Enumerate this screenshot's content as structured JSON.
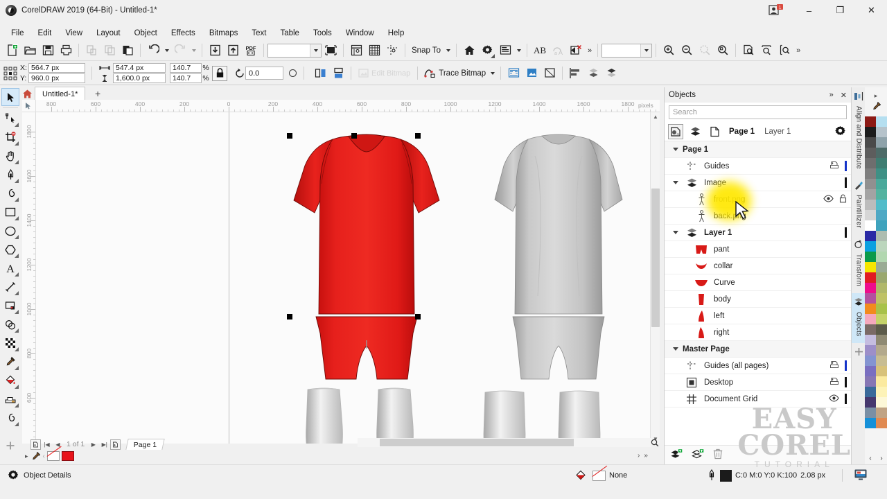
{
  "window": {
    "title": "CorelDRAW 2019 (64-Bit) - Untitled-1*",
    "minimize": "–",
    "maximize": "❐",
    "close": "✕"
  },
  "menubar": {
    "items": [
      {
        "label": "File",
        "accel": "F"
      },
      {
        "label": "Edit",
        "accel": "E"
      },
      {
        "label": "View",
        "accel": "V"
      },
      {
        "label": "Layout",
        "accel": "L"
      },
      {
        "label": "Object",
        "accel": "b"
      },
      {
        "label": "Effects",
        "accel": "c"
      },
      {
        "label": "Bitmaps",
        "accel": "B"
      },
      {
        "label": "Text",
        "accel": "x"
      },
      {
        "label": "Table",
        "accel": "T"
      },
      {
        "label": "Tools",
        "accel": "o"
      },
      {
        "label": "Window",
        "accel": "W"
      },
      {
        "label": "Help",
        "accel": "H"
      }
    ]
  },
  "standard_toolbar": {
    "snap_to_label": "Snap To",
    "pdf_label": "PDF",
    "text_label": "AB",
    "zoom_level_value": "",
    "zoom_level_placeholder": "",
    "overflow_label": "»",
    "icons": [
      "new-document-icon",
      "open-document-icon",
      "save-document-icon",
      "print-icon",
      "cut-icon",
      "copy-icon",
      "paste-icon",
      "undo-icon",
      "redo-icon",
      "import-icon",
      "export-icon",
      "publish-pdf-icon",
      "zoom-levels-combo",
      "full-screen-preview-icon",
      "show-rulers-icon",
      "show-grid-icon",
      "show-guides-icon",
      "snap-to-icon",
      "welcome-screen-icon",
      "options-icon",
      "application-launcher-icon",
      "text-properties-icon",
      "alignment-guides-icon",
      "clear-transform-icon",
      "zoom-in-icon",
      "zoom-out-icon",
      "zoom-selected-icon",
      "zoom-all-objects-icon",
      "zoom-page-icon",
      "zoom-page-width-icon",
      "zoom-page-height-icon"
    ]
  },
  "property_bar": {
    "x_label": "X:",
    "y_label": "Y:",
    "x_value": "564.7 px",
    "y_value": "960.0 px",
    "width_value": "547.4 px",
    "height_value": "1,600.0 px",
    "scale_w_value": "140.7",
    "scale_h_value": "140.7",
    "percent_symbol": "%",
    "rotation_value": "0.0",
    "trace_bitmap_label": "Trace Bitmap",
    "edit_bitmap_label": "Edit Bitmap"
  },
  "document_tabs": {
    "home_icon": "home-icon",
    "active_tab": "Untitled-1*",
    "new_tab_label": "+"
  },
  "toolbox": {
    "tools": [
      {
        "name": "pick-tool",
        "active": true
      },
      {
        "name": "shape-tool",
        "active": false
      },
      {
        "name": "crop-tool",
        "active": false
      },
      {
        "name": "pan-tool",
        "active": false
      },
      {
        "name": "pen-tool",
        "active": false
      },
      {
        "name": "freehand-tool",
        "active": false
      },
      {
        "name": "rectangle-tool",
        "active": false
      },
      {
        "name": "ellipse-tool",
        "active": false
      },
      {
        "name": "polygon-tool",
        "active": false
      },
      {
        "name": "text-tool",
        "active": false
      },
      {
        "name": "dimension-tool",
        "active": false
      },
      {
        "name": "drop-shadow-tool",
        "active": false
      },
      {
        "name": "transparency-tool",
        "active": false
      },
      {
        "name": "pattern-fill-tool",
        "active": false
      },
      {
        "name": "color-eyedropper-tool",
        "active": false
      },
      {
        "name": "interactive-fill-tool",
        "active": false
      },
      {
        "name": "smart-fill-tool",
        "active": false
      },
      {
        "name": "connector-tool",
        "active": false
      },
      {
        "name": "add-tool-button",
        "active": false
      }
    ]
  },
  "rulers": {
    "unit": "pixels",
    "h_labels": [
      "800",
      "600",
      "400",
      "200",
      "0",
      "200",
      "400",
      "600",
      "800",
      "1000",
      "1200",
      "1400",
      "1600",
      "1800"
    ],
    "v_labels": [
      "1800",
      "1600",
      "1400",
      "1200",
      "1000",
      "800",
      "600"
    ]
  },
  "page_navigator": {
    "page_indicator": "1 of 1",
    "page_tab": "Page 1"
  },
  "status_bar": {
    "object_details_label": "Object Details",
    "fill_label": "None",
    "outline_color": "C:0 M:0 Y:0 K:100",
    "outline_width": "2.08 px"
  },
  "docker": {
    "title": "Objects",
    "collapse_icon": "»",
    "close_icon": "✕",
    "search_placeholder": "Search",
    "page_label": "Page 1",
    "layer_label": "Layer 1",
    "tree": [
      {
        "id": "page-1",
        "label": "Page 1",
        "icon": "page-icon",
        "indent": 0,
        "bold": true,
        "expander": true,
        "type": "group"
      },
      {
        "id": "guides",
        "label": "Guides",
        "icon": "guides-icon",
        "indent": 1,
        "bold": false,
        "expander": false,
        "type": "layer",
        "print_icon": true,
        "color": "#1433c8"
      },
      {
        "id": "image",
        "label": "Image",
        "icon": "layer-icon",
        "indent": 1,
        "bold": false,
        "expander": true,
        "type": "layer",
        "color": "#111111"
      },
      {
        "id": "front-png",
        "label": "front.png",
        "icon": "bitmap-icon",
        "indent": 2,
        "bold": false,
        "type": "object",
        "eye_icon": true,
        "lock_icon": true,
        "highlighted": true
      },
      {
        "id": "back-png",
        "label": "back.png",
        "icon": "bitmap-icon",
        "indent": 2,
        "bold": false,
        "type": "object"
      },
      {
        "id": "layer-1",
        "label": "Layer 1",
        "icon": "layer-icon",
        "indent": 1,
        "bold": true,
        "expander": true,
        "type": "layer",
        "color": "#111111"
      },
      {
        "id": "pant",
        "label": "pant",
        "icon": "shape-pant-icon",
        "indent": 2,
        "bold": false,
        "type": "object"
      },
      {
        "id": "collar",
        "label": "collar",
        "icon": "shape-collar-icon",
        "indent": 2,
        "bold": false,
        "type": "object"
      },
      {
        "id": "curve",
        "label": "Curve",
        "icon": "shape-curve-icon",
        "indent": 2,
        "bold": false,
        "type": "object"
      },
      {
        "id": "body",
        "label": "body",
        "icon": "shape-body-icon",
        "indent": 2,
        "bold": false,
        "type": "object"
      },
      {
        "id": "left",
        "label": "left",
        "icon": "shape-left-icon",
        "indent": 2,
        "bold": false,
        "type": "object"
      },
      {
        "id": "right",
        "label": "right",
        "icon": "shape-right-icon",
        "indent": 2,
        "bold": false,
        "type": "object"
      },
      {
        "id": "master-page",
        "label": "Master Page",
        "icon": "page-icon",
        "indent": 0,
        "bold": true,
        "expander": true,
        "type": "group"
      },
      {
        "id": "guides-all",
        "label": "Guides (all pages)",
        "icon": "guides-icon",
        "indent": 1,
        "bold": false,
        "type": "layer",
        "print_icon": true,
        "color": "#1433c8"
      },
      {
        "id": "desktop",
        "label": "Desktop",
        "icon": "desktop-icon",
        "indent": 1,
        "bold": false,
        "type": "layer",
        "print_icon": true,
        "color": "#111111"
      },
      {
        "id": "document-grid",
        "label": "Document Grid",
        "icon": "grid-icon",
        "indent": 1,
        "bold": false,
        "type": "layer",
        "eye_icon": true,
        "color": "#111111"
      }
    ],
    "footer_icons": [
      "new-layer-icon",
      "new-master-layer-icon",
      "delete-icon"
    ]
  },
  "docker_tabs": {
    "items": [
      {
        "label": "Align and Distribute",
        "icon": "align-icon",
        "active": false
      },
      {
        "label": "Paintillizer",
        "icon": "paintillizer-icon",
        "active": false
      },
      {
        "label": "Transform",
        "icon": "transform-icon",
        "active": false
      },
      {
        "label": "Objects",
        "icon": "objects-icon",
        "active": true
      },
      {
        "label": "+",
        "icon": "add-docker-icon",
        "active": false
      }
    ]
  },
  "color_palette": {
    "nav_prev": "‹",
    "nav_next": "›",
    "colors": [
      "#8c1a15",
      "#b5dff0",
      "#1c1c1c",
      "#b6c3cb",
      "#4a4a4a",
      "#8fa3ab",
      "#5d5d5d",
      "#4d6b68",
      "#6e6e6e",
      "#3f7d72",
      "#7e7e7e",
      "#3e9085",
      "#909090",
      "#4aa99b",
      "#a3a3a3",
      "#54b3a0",
      "#bcbcbc",
      "#52bcc9",
      "#d6d6d6",
      "#4fa8c4",
      "#ffffff",
      "#3fa3bd",
      "#2a2aa5",
      "#aebdb0",
      "#0aa0e0",
      "#bcd6bd",
      "#0a9a4a",
      "#b2d7b0",
      "#f5e600",
      "#9aab94",
      "#e11b22",
      "#9aa86e",
      "#ee0d8c",
      "#b0b86a",
      "#b3519f",
      "#bfc266",
      "#f28b1e",
      "#a8c24a",
      "#f5a8bd",
      "#c5d36a",
      "#7a6a66",
      "#5c5b4a",
      "#c5bde0",
      "#8f8a73",
      "#9d8fc9",
      "#b3a98c",
      "#8494d1",
      "#c8bd92",
      "#7a6fc0",
      "#d8c27a",
      "#8777b4",
      "#fbeaa0",
      "#3a6a9a",
      "#fdf3b8",
      "#46386e",
      "#fdf8d8",
      "#7a8fa5",
      "#c0a384",
      "#1590d8",
      "#e08a52"
    ]
  },
  "watermark": {
    "line1": "EASY",
    "line2": "COREL",
    "line3": "TUTORIAL"
  },
  "canvas": {
    "artwork_description": "soccer kit mockup front red and back grey with socks",
    "jersey_color": "#e8201d",
    "back_color": "#c6c6c6",
    "selection_handles": 6
  }
}
